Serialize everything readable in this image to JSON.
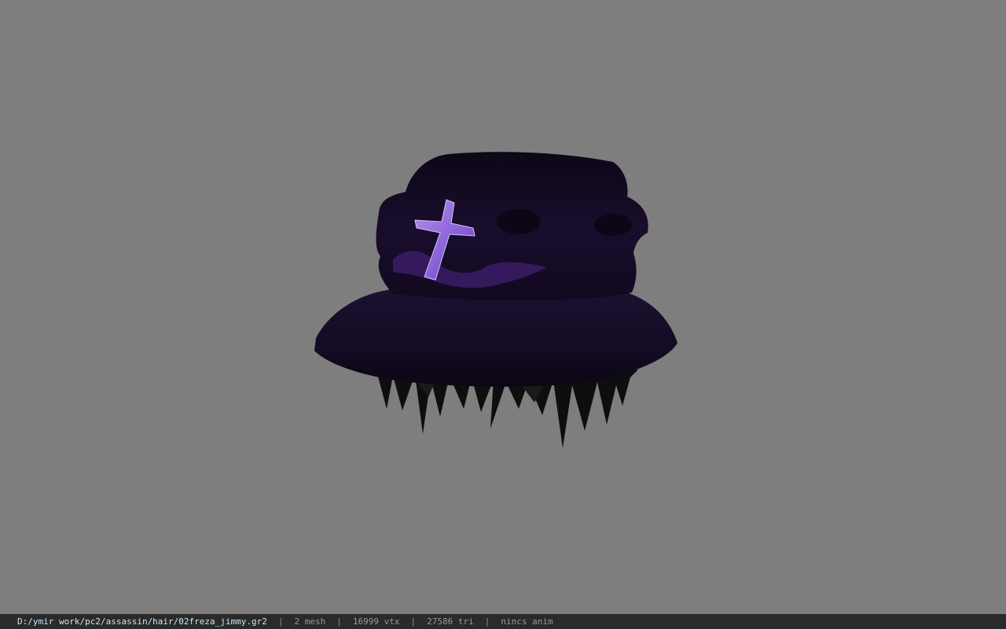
{
  "viewer": {
    "background_color": "#7e7e7e",
    "model": {
      "description_icon": "bucket-hat-model",
      "hat_color": "#140a22",
      "emblem_color": "#8a5ad6",
      "hair_color": "#0e0e0e"
    }
  },
  "status_bar": {
    "file_path": "D:/ymir work/pc2/assassin/hair/02freza_jimmy.gr2",
    "separator": "|",
    "mesh_count": "2 mesh",
    "vertex_count": "16999 vtx",
    "triangle_count": "27586 tri",
    "anim": "nincs anim"
  }
}
